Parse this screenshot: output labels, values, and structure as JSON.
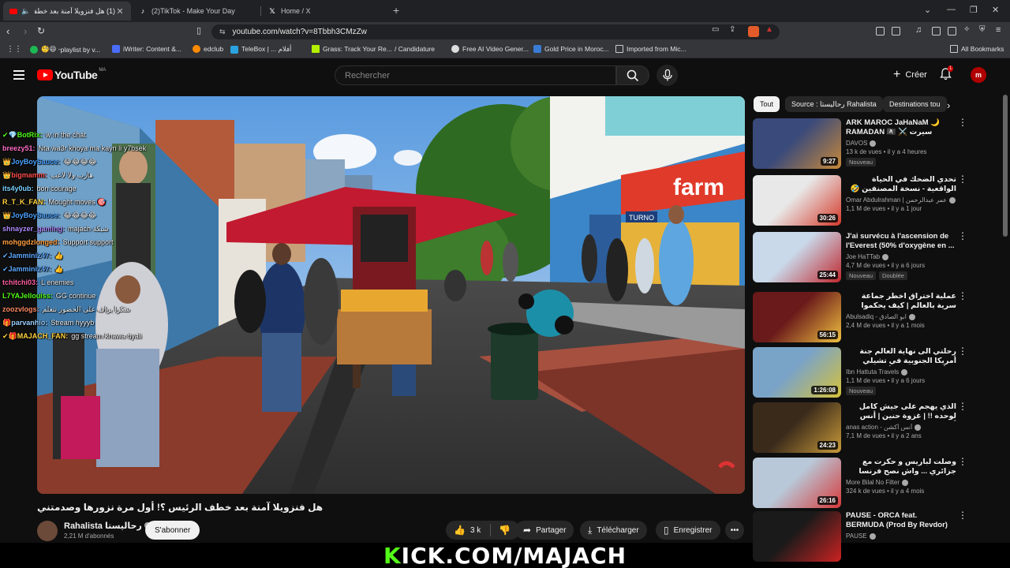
{
  "browser": {
    "tabs": [
      {
        "title": "(1) هل فنزويلا آمنة بعد خطف",
        "active": true
      },
      {
        "title": "(2)TikTok - Make Your Day",
        "active": false
      },
      {
        "title": "Home / X",
        "active": false
      }
    ],
    "url": "youtube.com/watch?v=8Tbbh3CMzZw",
    "bookmarks": [
      "playlist by v...",
      "iWriter: Content &...",
      "edclub",
      "TeleBox | ... أفلام",
      "Grass: Track Your Re...",
      "/ Candidature",
      "Free AI Video Gener...",
      "Gold Price in Moroc...",
      "Imported from Mic..."
    ],
    "all_bookmarks": "All Bookmarks"
  },
  "youtube": {
    "logo_text": "YouTube",
    "country_code": "MA",
    "search_placeholder": "Rechercher",
    "create_label": "Créer",
    "notification_count": "1"
  },
  "chat": [
    {
      "user": "✔💎BotRix:",
      "msg": "w ın the chat",
      "color": "#53fc18"
    },
    {
      "user": "breezy51:",
      "msg": "Nta wa3r khoya ma kayn li y7bsek",
      "color": "#ff6ec7"
    },
    {
      "user": "👑JoyBoySauce:",
      "msg": "😂😂😂😂",
      "color": "#4aa3ff"
    },
    {
      "user": "👑bigmamm:",
      "msg": "هارب ولا لاعب",
      "color": "#ff4d4d"
    },
    {
      "user": "its4y0ub:",
      "msg": "bon courage",
      "color": "#7ad0ff"
    },
    {
      "user": "R_T_K_FAN:",
      "msg": "Mought moves 🎯",
      "color": "#ffd23f"
    },
    {
      "user": "👑JoyBoySauce:",
      "msg": "😂😂😂😂",
      "color": "#4aa3ff"
    },
    {
      "user": "shnayzer_gaming:",
      "msg": "majach شبكة",
      "color": "#b18cff"
    },
    {
      "user": "mohggdzlonged:",
      "msg": "Support support",
      "color": "#ff9f43"
    },
    {
      "user": "✔Jammini247:",
      "msg": "👍",
      "color": "#5da9ff"
    },
    {
      "user": "✔Jammini247:",
      "msg": "👍",
      "color": "#5da9ff"
    },
    {
      "user": "tchitchi03:",
      "msg": "L enemies",
      "color": "#ff5fa2"
    },
    {
      "user": "L7YAJellouiss:",
      "msg": "GG continue",
      "color": "#53fc18"
    },
    {
      "user": "zoozvlogs:",
      "msg": "شكرا يزاف على الحضور نتعلم",
      "color": "#ff8a65"
    },
    {
      "user": "🎁parvanhio:",
      "msg": "Stream hyyyb",
      "color": "#9ad0ff"
    },
    {
      "user": "✔🎁MAJACH_FAN:",
      "msg": "gg stream khawa dyali",
      "color": "#ffd23f"
    }
  ],
  "video": {
    "title": "هل فنزويلا آمنة بعد خطف الرئيس ؟! أول مرة نزورها وصدمتني",
    "channel": "Rahalista رحاليستا",
    "subscribers": "2,21 M d'abonnés",
    "subscribe_label": "S'abonner",
    "likes": "3 k",
    "share_label": "Partager",
    "download_label": "Télécharger",
    "save_label": "Enregistrer",
    "overlay_text_brand": "farm",
    "overlay_text_turno": "TURNO"
  },
  "banner": {
    "k": "K",
    "rest": "ICK.COM/MAJACH"
  },
  "chips": [
    "Tout",
    "Source : رحاليستا Rahalista",
    "Destinations tou"
  ],
  "recommendations": [
    {
      "title": "ARK MAROC JaHaNaM 🌙 RAMADAN 🏴‍☠️ ⚔️ سيرت مسيحية جديدة",
      "channel": "DAVOS",
      "meta": "13 k de vues • il y a 4 heures",
      "badges": [
        "Nouveau"
      ],
      "duration": "9:27",
      "c1": "#3a4a7a",
      "c2": "#c8893a"
    },
    {
      "title": "تحدي الضحك في الحياة الواقعية - نسخة المصنفين 🤣 😂",
      "channel": "Omar Abdulrahman | عمر عبدالرحمن",
      "meta": "1,1 M de vues • il y a 1 jour",
      "badges": [],
      "duration": "30:26",
      "c1": "#e8e8e8",
      "c2": "#d43a2a"
    },
    {
      "title": "J'ai survécu à l'ascension de l'Everest (50% d'oxygène en ...",
      "channel": "Joe HaTTab",
      "meta": "4,7 M de vues • il y a 6 jours",
      "badges": [
        "Nouveau",
        "Doublée"
      ],
      "duration": "25:44",
      "c1": "#c9d9ea",
      "c2": "#c0272d"
    },
    {
      "title": "عملية اختراق اخطر جماعة سرية بالعالم | كيف يحكموا العالم",
      "channel": "Abulsadiq - ابو الصادق",
      "meta": "2,4 M de vues • il y a 1 mois",
      "badges": [],
      "duration": "56:15",
      "c1": "#6a1a1a",
      "c2": "#f0c040"
    },
    {
      "title": "رحلتي الى نهاية العالم جنة أمريكا الجنوبية في تشيلي والأرجنتين 🇦🇷 | بالأعورية",
      "channel": "Ibn Hattuta Travels",
      "meta": "1,1 M de vues • il y a 6 jours",
      "badges": [
        "Nouveau"
      ],
      "duration": "1:26:08",
      "c1": "#7aa3c8",
      "c2": "#d6c23a"
    },
    {
      "title": "الذي يهجم على جيش كامل لوحده !! | غزوة حنين | أنس أكشن",
      "channel": "anas action - أنس أكشن",
      "meta": "7,1 M de vues • il y a 2 ans",
      "badges": [],
      "duration": "24:23",
      "c1": "#3a2a1a",
      "c2": "#c89a3a"
    },
    {
      "title": "وصلت لباريس و حكرت مع جزائري ... واش نصح فرنسا فقا فيها ماوقد؟ |",
      "channel": "More Bilal No Filter",
      "meta": "324 k de vues • il y a 4 mois",
      "badges": [],
      "duration": "26:16",
      "c1": "#b8c8d8",
      "c2": "#d63a3a"
    },
    {
      "title": "PAUSE - ORCA feat. BERMUDA (Prod By Revdor)",
      "channel": "PAUSE",
      "meta": "",
      "badges": [],
      "duration": "",
      "c1": "#1a1a1a",
      "c2": "#cc2222"
    }
  ]
}
